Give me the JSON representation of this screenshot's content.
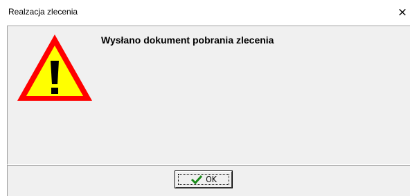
{
  "window": {
    "title": "Realzacja zlecenia",
    "close_glyph": "×"
  },
  "dialog": {
    "icon": "warning-icon",
    "message": "Wysłano dokument pobrania zlecenia"
  },
  "buttons": {
    "ok_label": "OK",
    "ok_icon": "check-icon"
  },
  "colors": {
    "panel_bg": "#f0f0f0",
    "warning_red": "#ff0000",
    "warning_yellow": "#ffff00",
    "check_green": "#1a8a1a"
  }
}
